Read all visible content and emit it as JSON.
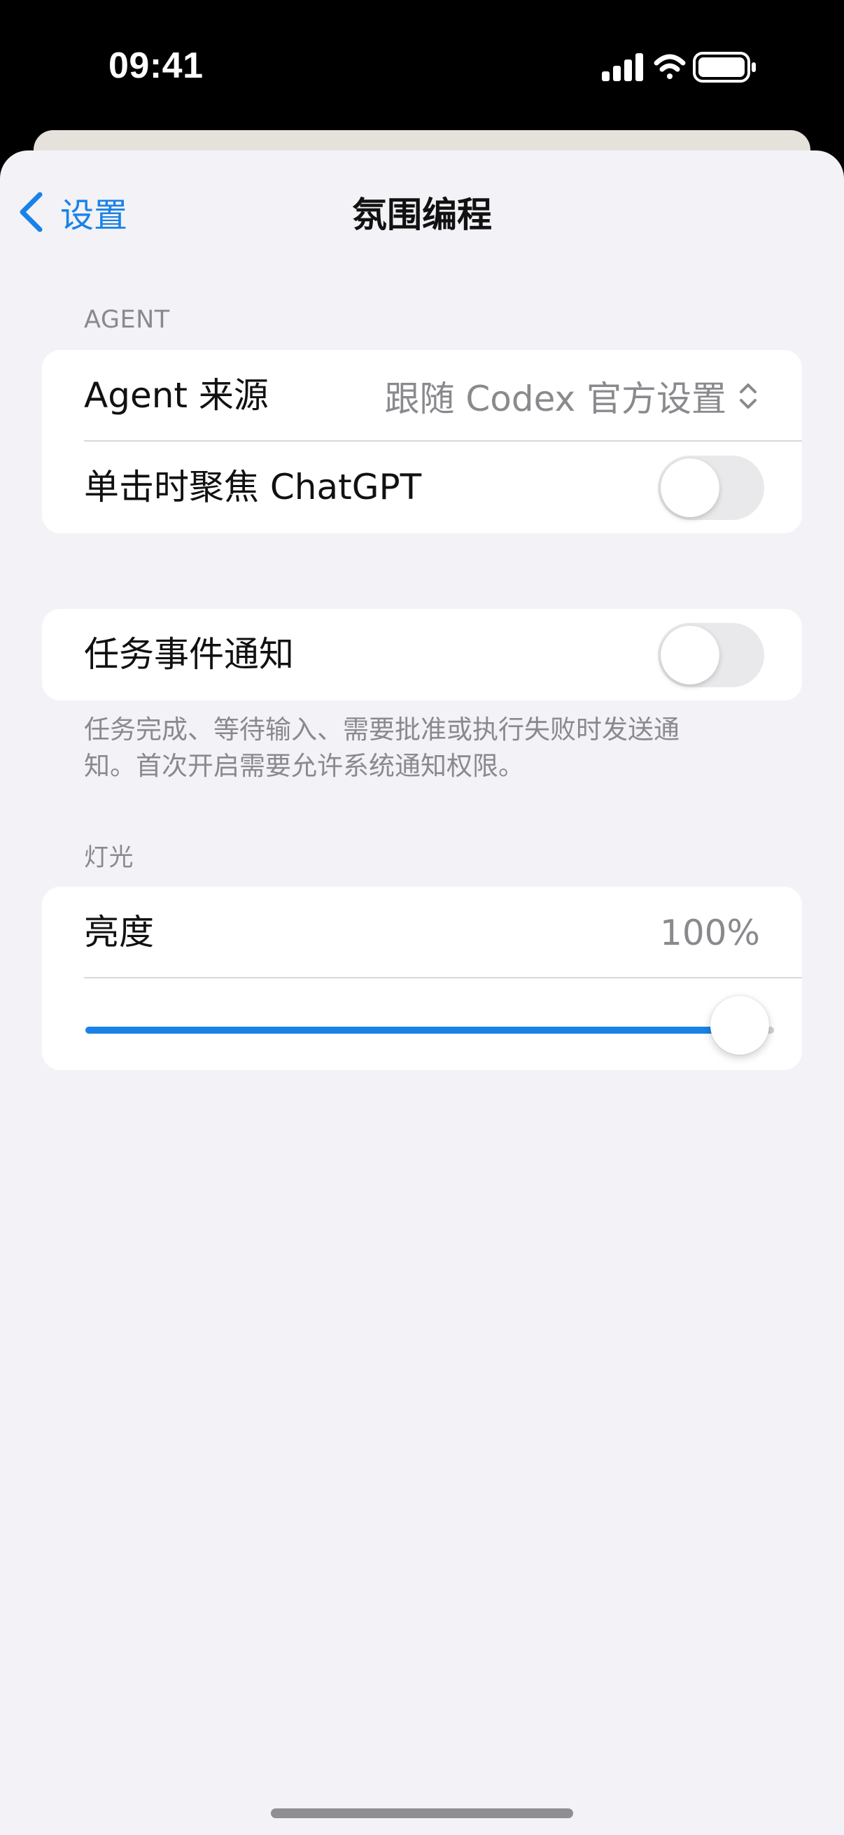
{
  "status_bar": {
    "time": "09:41",
    "signal_icon": "cellular-signal-icon",
    "wifi_icon": "wifi-icon",
    "battery_icon": "battery-icon"
  },
  "nav": {
    "back_label": "设置",
    "back_icon": "chevron-left-icon",
    "title": "氛围编程",
    "accent_color": "#1a82e6"
  },
  "agent_section": {
    "header": "AGENT",
    "source_label": "Agent 来源",
    "source_value": "跟随 Codex 官方设置",
    "source_icon": "chevron-up-down-icon",
    "focus_label": "单击时聚焦 ChatGPT",
    "focus_enabled": false
  },
  "notify_section": {
    "label": "任务事件通知",
    "enabled": false,
    "footer": "任务完成、等待输入、需要批准或执行失败时发送通知。首次开启需要允许系统通知权限。"
  },
  "light_section": {
    "header": "灯光",
    "brightness_label": "亮度",
    "brightness_value": "100%",
    "brightness_level": 0.95
  }
}
